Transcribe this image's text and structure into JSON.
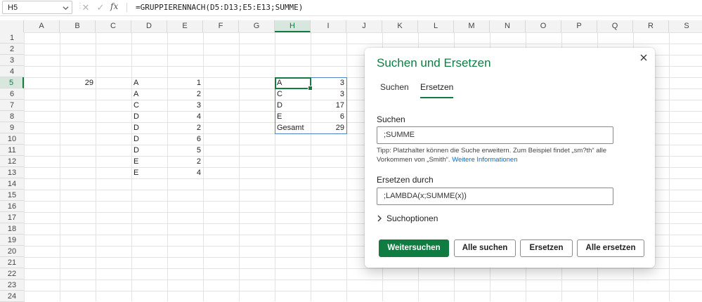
{
  "name_box": "H5",
  "formula": "=GRUPPIERENNACH(D5:D13;E5:E13;SUMME)",
  "columns": [
    "A",
    "B",
    "C",
    "D",
    "E",
    "F",
    "G",
    "H",
    "I",
    "J",
    "K",
    "L",
    "M",
    "N",
    "O",
    "P",
    "Q",
    "R",
    "S"
  ],
  "rows": [
    "1",
    "2",
    "3",
    "4",
    "5",
    "6",
    "7",
    "8",
    "9",
    "10",
    "11",
    "12",
    "13",
    "14",
    "15",
    "16",
    "17",
    "18",
    "19",
    "20",
    "21",
    "22",
    "23",
    "24"
  ],
  "cells": {
    "B5": "29",
    "D5": "A",
    "D6": "A",
    "D7": "C",
    "D8": "D",
    "D9": "D",
    "D10": "D",
    "D11": "D",
    "D12": "E",
    "D13": "E",
    "E5": "1",
    "E6": "2",
    "E7": "3",
    "E8": "4",
    "E9": "2",
    "E10": "6",
    "E11": "5",
    "E12": "2",
    "E13": "4",
    "H5": "A",
    "H6": "C",
    "H7": "D",
    "H8": "E",
    "H9": "Gesamt",
    "I5": "3",
    "I6": "3",
    "I7": "17",
    "I8": "6",
    "I9": "29"
  },
  "dialog": {
    "title": "Suchen und Ersetzen",
    "tab_search": "Suchen",
    "tab_replace": "Ersetzen",
    "search_label": "Suchen",
    "search_value": ";SUMME",
    "tip_text": "Tipp: Platzhalter können die Suche erweitern. Zum Beispiel findet „sm?th“ alle Vorkommen von „Smith“.",
    "tip_link": "Weitere Informationen",
    "replace_label": "Ersetzen durch",
    "replace_value": ";LAMBDA(x;SUMME(x))",
    "options_label": "Suchoptionen",
    "btn_find_next": "Weitersuchen",
    "btn_find_all": "Alle suchen",
    "btn_replace": "Ersetzen",
    "btn_replace_all": "Alle ersetzen"
  },
  "colors": {
    "accent": "#107c41",
    "link": "#0f6cbd",
    "spill_border": "#4a86c5"
  }
}
